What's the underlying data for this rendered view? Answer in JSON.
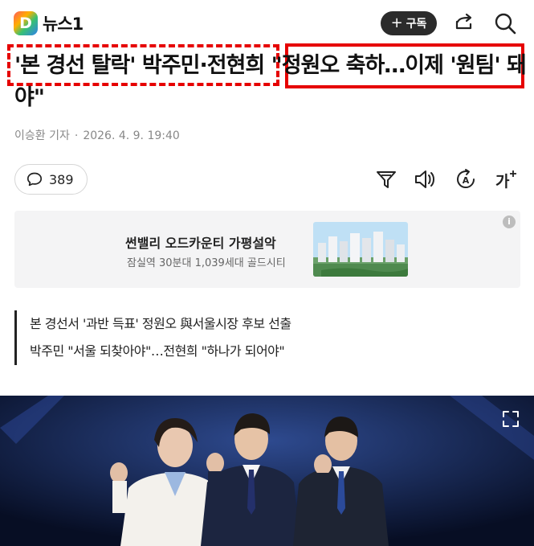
{
  "header": {
    "logo_text": "뉴스1",
    "subscribe_label": "구독",
    "subscribe_plus": "+"
  },
  "article": {
    "headline": "'본 경선 탈락' 박주민·전현희 \"정원오 축하…이제 '원팀' 돼야\"",
    "author": "이승환 기자",
    "separator": "·",
    "datetime": "2026. 4. 9. 19:40",
    "comment_count": "389",
    "summary": [
      "본 경선서 '과반 득표' 정원오 與서울시장 후보 선출",
      "박주민 \"서울 되찾아야\"…전현희 \"하나가 되어야\""
    ]
  },
  "ad": {
    "title": "썬밸리 오드카운티 가평설악",
    "subtitle": "잠실역 30분대 1,039세대 골드시티",
    "info_label": "i"
  },
  "icons": {
    "share": "share-icon",
    "search": "search-icon",
    "comment": "comment-icon",
    "filter": "filter-icon",
    "listen": "speaker-icon",
    "translate": "translate-icon",
    "font_size": "font-size-icon",
    "fullscreen": "fullscreen-icon"
  },
  "colors": {
    "highlight_red": "#e60000",
    "subscribe_bg": "#2b2b2b"
  }
}
